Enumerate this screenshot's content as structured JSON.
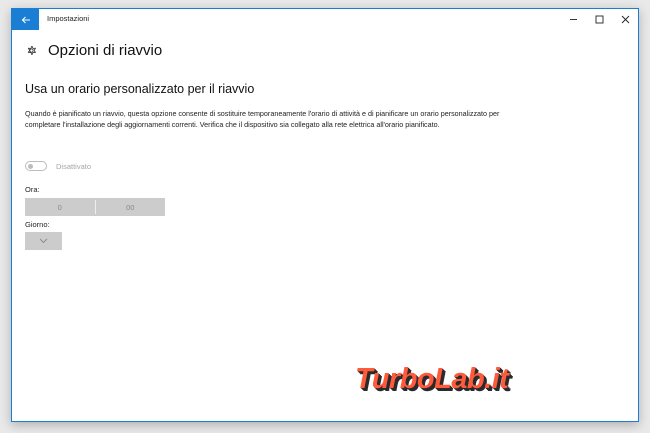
{
  "window": {
    "title": "Impostazioni"
  },
  "header": {
    "title": "Opzioni di riavvio"
  },
  "section": {
    "title": "Usa un orario personalizzato per il riavvio",
    "description": "Quando è pianificato un riavvio, questa opzione consente di sostituire temporaneamente l'orario di attività e di pianificare un orario personalizzato per completare l'installazione degli aggiornamenti correnti. Verifica che il dispositivo sia collegato alla rete elettrica all'orario pianificato."
  },
  "toggle": {
    "label": "Disattivato",
    "state": "off",
    "enabled": false
  },
  "time": {
    "label": "Ora:",
    "hour": "0",
    "minute": "00"
  },
  "day": {
    "label": "Giorno:",
    "value": ""
  },
  "watermark": {
    "text": "TurboLab.it"
  },
  "colors": {
    "accent": "#1a7fd4",
    "watermark": "#ff5a3c",
    "disabled_control": "#cccccc"
  },
  "icons": {
    "back": "back-arrow-icon",
    "settings": "gear-icon",
    "minimize": "minimize-icon",
    "maximize": "maximize-icon",
    "close": "close-icon",
    "dropdown": "chevron-down-icon"
  }
}
